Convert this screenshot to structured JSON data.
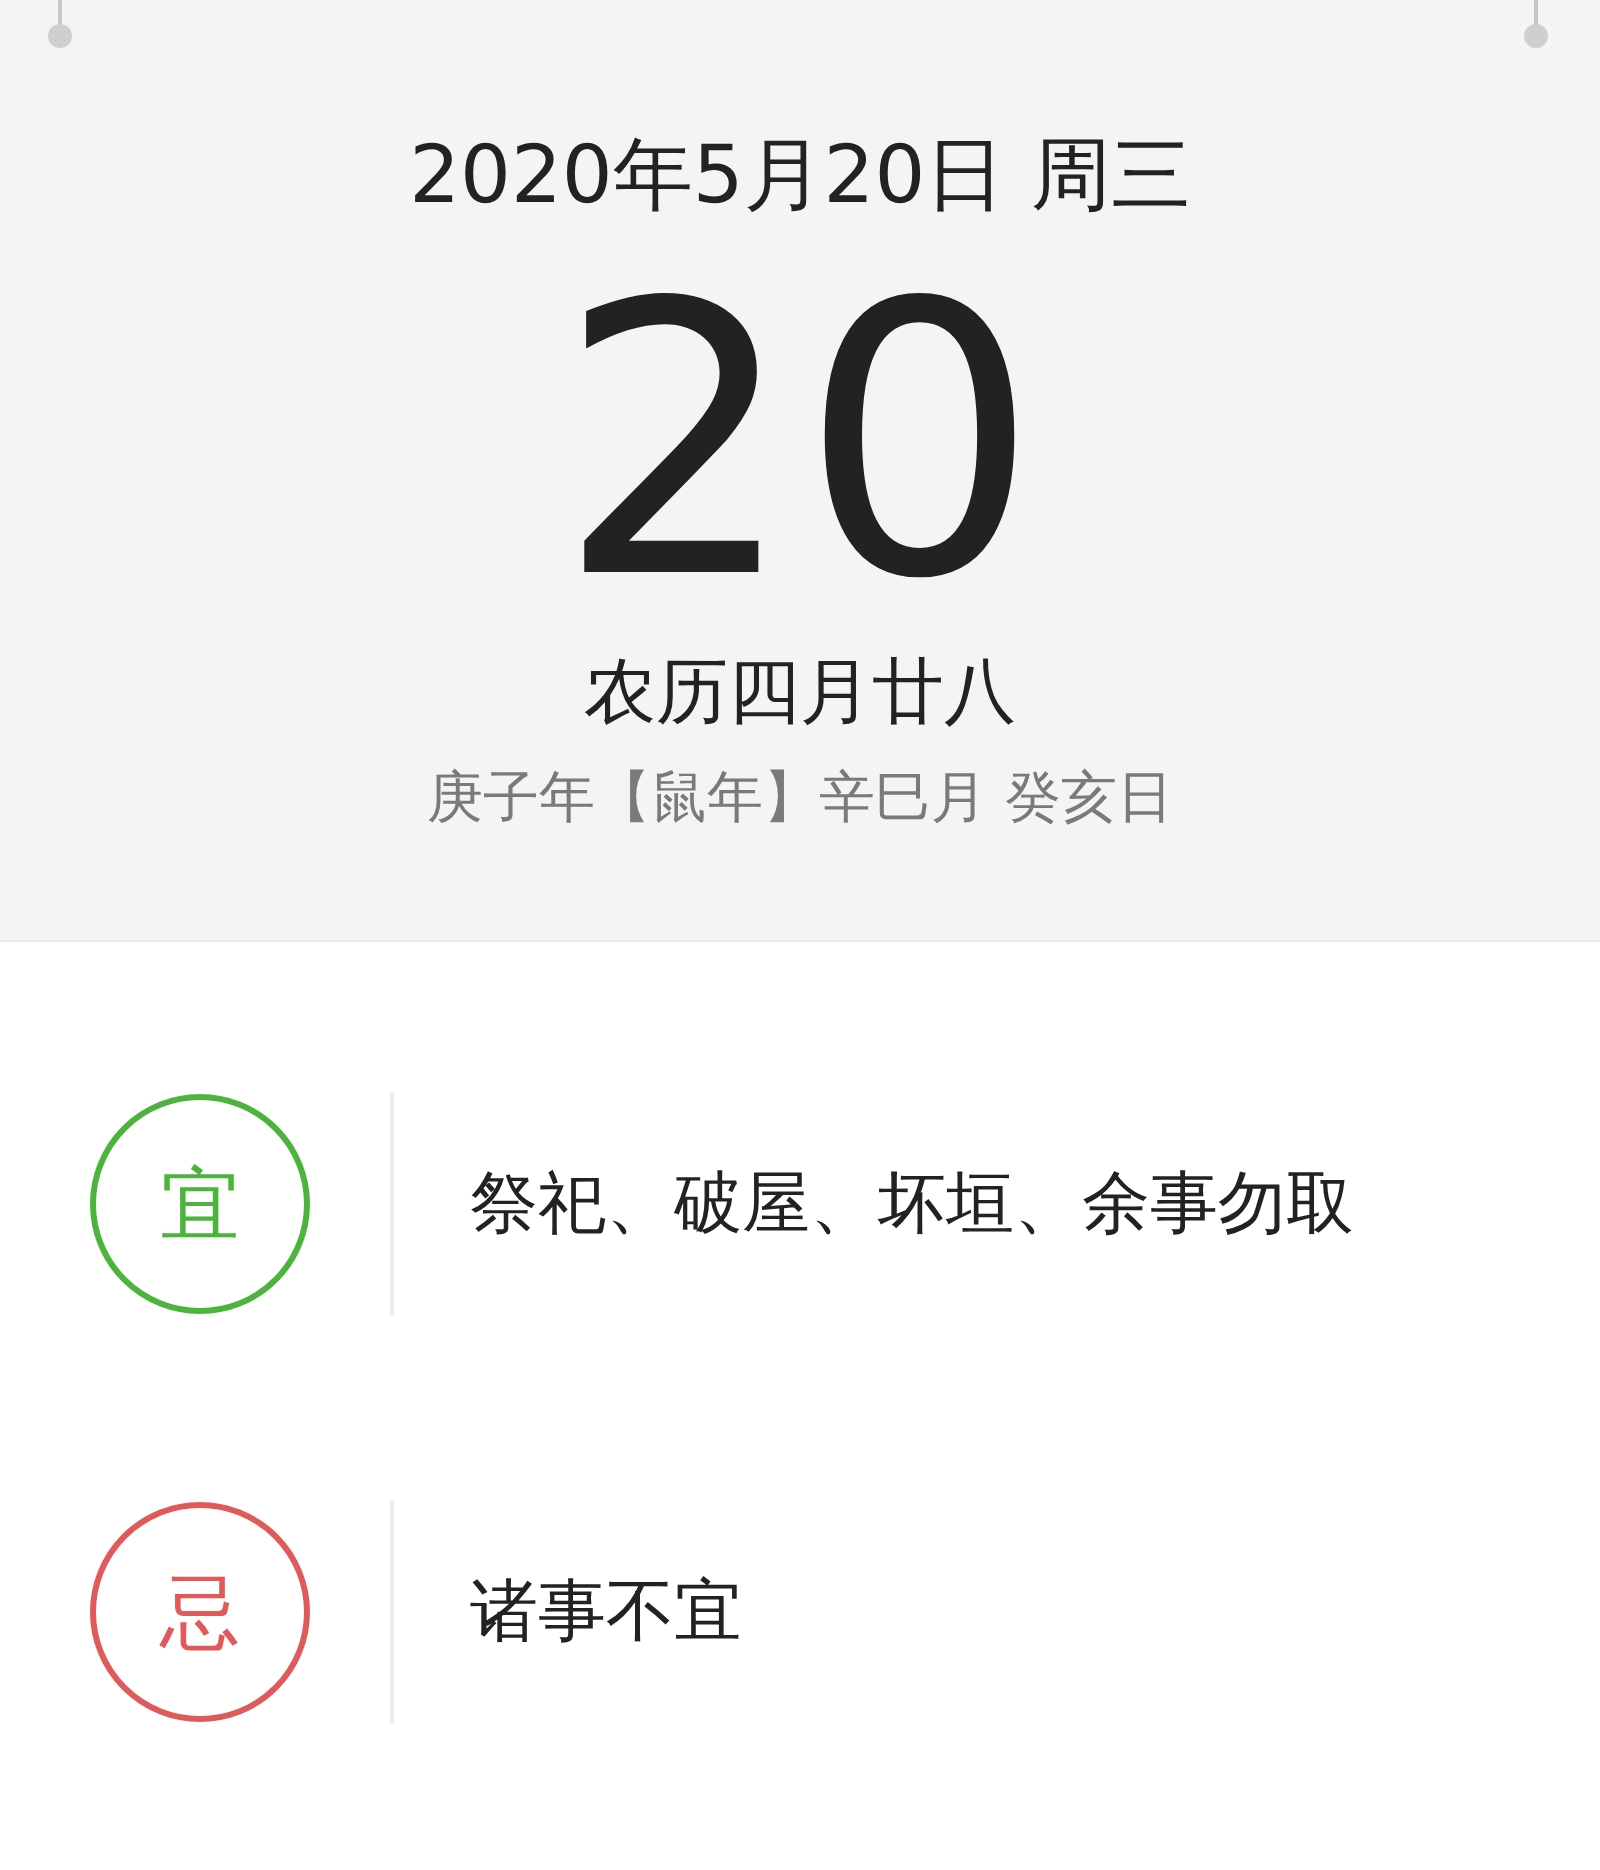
{
  "header": {
    "date": "2020年5月20日 周三",
    "day": "20",
    "lunar": "农历四月廿八",
    "ganzhi": "庚子年【鼠年】辛巳月 癸亥日"
  },
  "entries": [
    {
      "badge": "宜",
      "color": "#4cb43c",
      "text": "祭祀、破屋、坏垣、余事勿取"
    },
    {
      "badge": "忌",
      "color": "#e05a5a",
      "text": "诸事不宜"
    }
  ]
}
